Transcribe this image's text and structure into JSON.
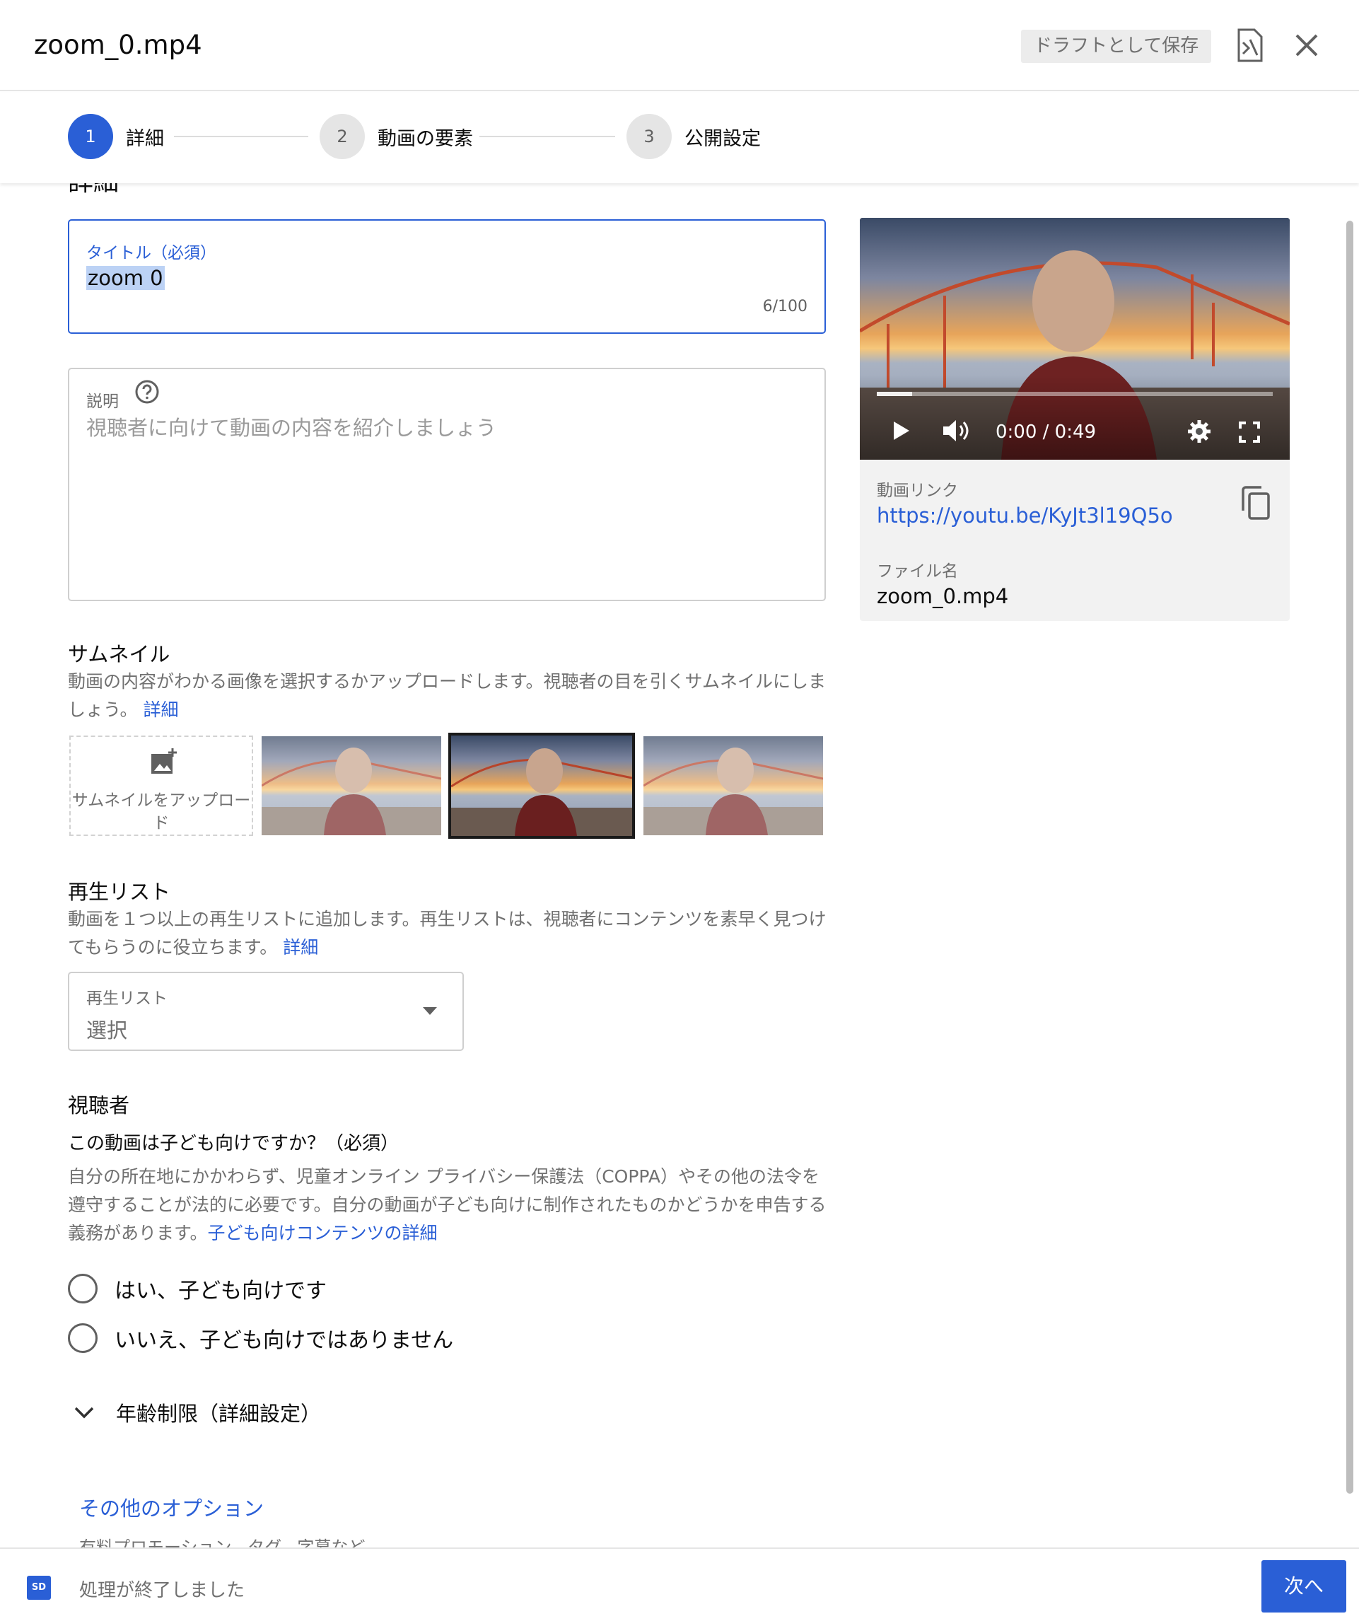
{
  "header": {
    "title": "zoom_0.mp4",
    "save_draft_label": "ドラフトとして保存"
  },
  "stepper": {
    "steps": [
      {
        "number": "1",
        "label": "詳細",
        "active": true
      },
      {
        "number": "2",
        "label": "動画の要素",
        "active": false
      },
      {
        "number": "3",
        "label": "公開設定",
        "active": false
      }
    ]
  },
  "details": {
    "section_heading": "詳細",
    "title_field": {
      "label": "タイトル（必須）",
      "value": "zoom 0",
      "counter": "6/100"
    },
    "description_field": {
      "label": "説明",
      "placeholder": "視聴者に向けて動画の内容を紹介しましょう"
    }
  },
  "thumbnail": {
    "heading": "サムネイル",
    "description": "動画の内容がわかる画像を選択するかアップロードします。視聴者の目を引くサムネイルにしましょう。",
    "learn_more": "詳細",
    "upload_label": "サムネイルをアップロード",
    "selected_index": 1
  },
  "playlist": {
    "heading": "再生リスト",
    "description": "動画を１つ以上の再生リストに追加します。再生リストは、視聴者にコンテンツを素早く見つけてもらうのに役立ちます。",
    "learn_more": "詳細",
    "select_label": "再生リスト",
    "select_value": "選択"
  },
  "audience": {
    "heading": "視聴者",
    "question": "この動画は子ども向けですか？（必須）",
    "description": "自分の所在地にかかわらず、児童オンライン プライバシー保護法（COPPA）やその他の法令を遵守することが法的に必要です。自分の動画が子ども向けに制作されたものかどうかを申告する義務があります。",
    "learn_more": "子ども向けコンテンツの詳細",
    "options": [
      "はい、子ども向けです",
      "いいえ、子ども向けではありません"
    ]
  },
  "age_restriction": {
    "label": "年齢制限（詳細設定）"
  },
  "more_options": {
    "label": "その他のオプション",
    "sub": "有料プロモーション、タグ、字幕など"
  },
  "video": {
    "time": "0:00 / 0:49",
    "progress_fraction": 0.09,
    "link_label": "動画リンク",
    "link": "https://youtu.be/KyJt3l19Q5o",
    "filename_label": "ファイル名",
    "filename": "zoom_0.mp4"
  },
  "footer": {
    "badge": "SD",
    "status": "処理が終了しました",
    "next_label": "次へ"
  },
  "colors": {
    "accent": "#2a5fd6",
    "text_secondary": "#707070"
  }
}
